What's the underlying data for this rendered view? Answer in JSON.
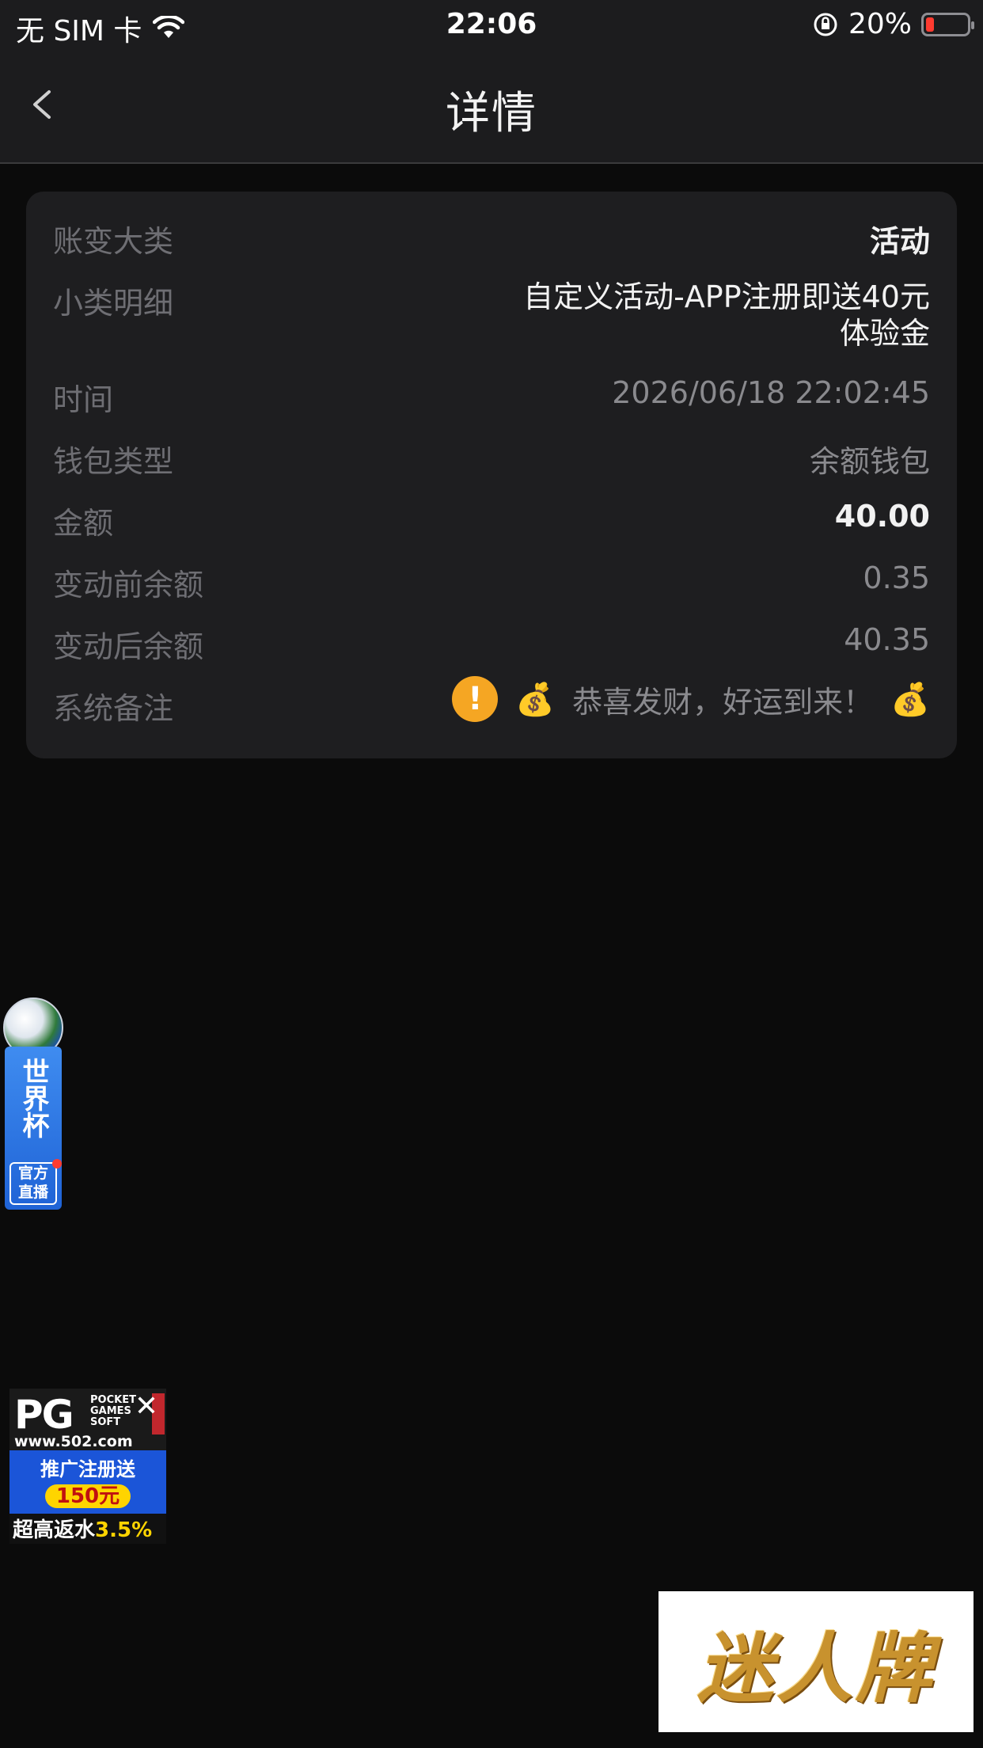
{
  "status_bar": {
    "carrier": "无 SIM 卡",
    "time": "22:06",
    "battery_percent": "20%",
    "battery_level": 0.2
  },
  "nav": {
    "title": "详情"
  },
  "details": {
    "category": {
      "label": "账变大类",
      "value": "活动"
    },
    "subcategory": {
      "label": "小类明细",
      "value_line1": "自定义活动-APP注册即送40元",
      "value_line2": "体验金"
    },
    "time": {
      "label": "时间",
      "value": "2026/06/18 22:02:45"
    },
    "wallet_type": {
      "label": "钱包类型",
      "value": "余额钱包"
    },
    "amount": {
      "label": "金额",
      "value": "40.00"
    },
    "balance_before": {
      "label": "变动前余额",
      "value": "0.35"
    },
    "balance_after": {
      "label": "变动后余额",
      "value": "40.35"
    },
    "remark": {
      "label": "系统备注",
      "value": "恭喜发财，好运到来！",
      "icon": "warning-icon",
      "emoji": "💰"
    }
  },
  "floating": {
    "world_cup": {
      "title": "世界杯",
      "sub_line1": "官方",
      "sub_line2": "直播"
    },
    "pg_ad": {
      "logo": "PG",
      "small_line1": "POCKET",
      "small_line2": "GAMES",
      "small_line3": "SOFT",
      "url": "www.502.com",
      "line1": "推广注册送",
      "bonus": "150元",
      "bottom_prefix": "超高返水",
      "bottom_highlight": "3.5%",
      "close": "✕"
    },
    "brand": {
      "text": "迷人牌"
    }
  },
  "colors": {
    "background": "#0b0b0b",
    "card": "#1e1e20",
    "label": "#6e6e73",
    "warning": "#f5a623",
    "battery_low": "#ff3b30"
  }
}
